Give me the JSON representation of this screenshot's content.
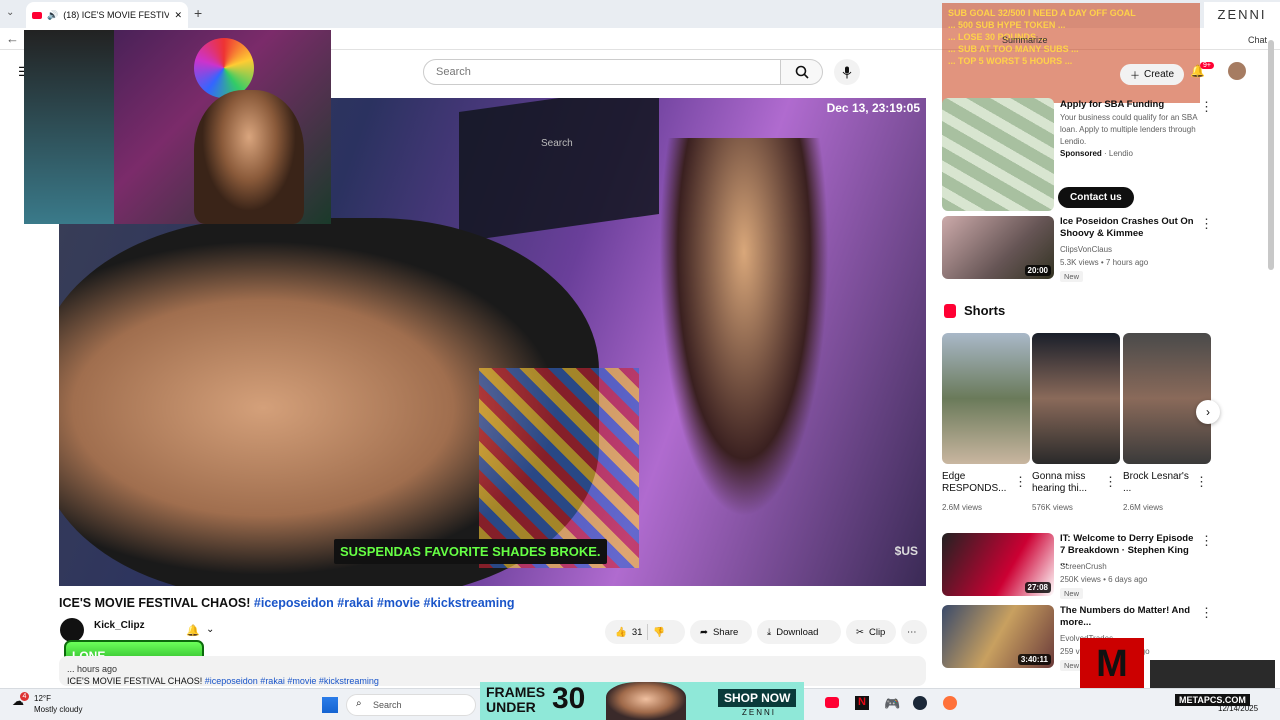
{
  "browser": {
    "tab_title": "(18) ICE'S MOVIE FESTIVAL CH...",
    "new_tab": "+"
  },
  "yt_header": {
    "search_placeholder": "Search",
    "summarize_label": "Summarize",
    "chat_label": "Chat",
    "create_label": "Create",
    "notif_count": "9+"
  },
  "player": {
    "timestamp": "Dec 13, 23:19:05",
    "caption": "SUSPENDAS FAVORITE SHADES BROKE.",
    "watermark": "$US",
    "screen_search": "Search"
  },
  "video": {
    "title": "ICE'S MOVIE FESTIVAL CHAOS!",
    "tags": [
      "#iceposeidon",
      "#rakai",
      "#movie",
      "#kickstreaming"
    ],
    "channel": "Kick_Clipz",
    "lone_label": "LONE",
    "likes": "31",
    "share_label": "Share",
    "download_label": "Download",
    "clip_label": "Clip",
    "desc_date": "... hours ago",
    "desc_text": "ICE'S MOVIE FESTIVAL CHAOS!",
    "desc_tags": "#iceposeidon #rakai #movie #kickstreaming"
  },
  "stream_overlay": {
    "lines": [
      "SUB GOAL 32/500 I NEED A DAY OFF GOAL",
      "... 500 SUB HYPE TOKEN ...",
      "... LOSE 30 POUNDS ...",
      "... SUB AT TOO MANY SUBS ...",
      "... TOP 5 WORST 5 HOURS ..."
    ],
    "brand": "ZENNI"
  },
  "ad": {
    "title": "Apply for SBA Funding",
    "text": "Your business could qualify for an SBA loan. Apply to multiple lenders through Lendio.",
    "sponsored": "Sponsored",
    "advertiser": "Lendio",
    "cta": "Contact us"
  },
  "related": [
    {
      "title": "Ice Poseidon Crashes Out On Shoovy & Kimmee",
      "channel": "ClipsVonClaus",
      "meta": "5.3K views • 7 hours ago",
      "badge": "New",
      "duration": "20:00"
    },
    {
      "title": "IT: Welcome to Derry Episode 7 Breakdown · Stephen King ...",
      "channel": "ScreenCrush",
      "meta": "250K views • 6 days ago",
      "badge": "New",
      "duration": "27:08"
    },
    {
      "title": "The Numbers do Matter! And more...",
      "channel": "EvolvedTrades",
      "meta": "259 views • 21 hours ago",
      "badge": "New",
      "duration": "3:40:11"
    }
  ],
  "shorts": {
    "header": "Shorts",
    "items": [
      {
        "title": "Edge RESPONDS...",
        "views": "2.6M views"
      },
      {
        "title": "Gonna miss hearing thi...",
        "views": "576K views"
      },
      {
        "title": "Brock Lesnar's ...",
        "views": "2.6M views"
      }
    ]
  },
  "taskbar": {
    "weather_temp": "12°F",
    "weather_desc": "Mostly cloudy",
    "search_placeholder": "Search",
    "date": "12/14/2025",
    "ad_line1": "FRAMES",
    "ad_line2": "UNDER",
    "ad_price": "30",
    "ad_cta": "SHOP NOW",
    "ad_brand": "ZENNI",
    "corner_brand": "METAPCS.COM",
    "notif_badge": "4"
  },
  "colors": {
    "accent_red": "#ff0033",
    "link_blue": "#1a55c9",
    "caption_green": "#66ff44"
  }
}
